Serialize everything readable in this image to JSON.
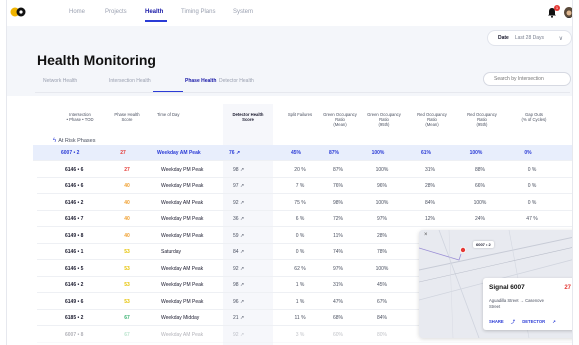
{
  "nav": {
    "items": [
      {
        "label": "Home",
        "active": false
      },
      {
        "label": "Projects",
        "active": false
      },
      {
        "label": "Health",
        "active": true
      },
      {
        "label": "Timing Plans",
        "active": false
      },
      {
        "label": "System",
        "active": false
      }
    ],
    "notification_count": "1"
  },
  "date_filter": {
    "label": "Date",
    "value": "Last 28 Days"
  },
  "page_title": "Health Monitoring",
  "tabs": [
    {
      "label": "Network Health",
      "active": false
    },
    {
      "label": "Intersection Health",
      "active": false
    },
    {
      "label": "Phase Health",
      "active": true
    },
    {
      "label": "Detector Health",
      "active": false
    }
  ],
  "search": {
    "placeholder": "Search by Intersection"
  },
  "table": {
    "headers": {
      "intersection": "Intersection",
      "intersection_sub": "• Phase • TOD",
      "score": "Phase Health",
      "score_sub": "Score",
      "tod": "Time of Day",
      "dhs": "Detector Health",
      "dhs_sub": "Score",
      "sf": "Split Failures",
      "gm": "Green Occupancy",
      "gm_sub": "Ratio",
      "gm_sub2": "(Mean)",
      "g5": "Green Occupancy",
      "g5_sub": "Ratio",
      "g5_sub2": "(95th)",
      "rm": "Red Occupancy",
      "rm_sub": "Ratio",
      "rm_sub2": "(Mean)",
      "r5": "Red Occupancy",
      "r5_sub": "Ratio",
      "r5_sub2": "(95th)",
      "go": "Gap Outs",
      "go_sub": "(% of Cycles)"
    },
    "group_label": "At Risk Phases",
    "rows": [
      {
        "id": "6007 • 2",
        "score": "27",
        "tod": "Weekday AM Peak",
        "dhs": "76 ↗",
        "sf": "45%",
        "gm": "87%",
        "g5": "100%",
        "rm": "61%",
        "r5": "100%",
        "go": "0%"
      },
      {
        "id": "6146 • 6",
        "score": "27",
        "tod": "Weekday PM Peak",
        "dhs": "98 ↗",
        "sf": "20 %",
        "gm": "87%",
        "g5": "100%",
        "rm": "31%",
        "r5": "88%",
        "go": "0 %"
      },
      {
        "id": "6146 • 6",
        "score": "40",
        "tod": "Weekday PM Peak",
        "dhs": "97 ↗",
        "sf": "7 %",
        "gm": "76%",
        "g5": "96%",
        "rm": "28%",
        "r5": "66%",
        "go": "0 %"
      },
      {
        "id": "6146 • 2",
        "score": "40",
        "tod": "Weekday AM Peak",
        "dhs": "92 ↗",
        "sf": "75 %",
        "gm": "98%",
        "g5": "100%",
        "rm": "84%",
        "r5": "100%",
        "go": "0 %"
      },
      {
        "id": "6146 • 7",
        "score": "40",
        "tod": "Weekday PM Peak",
        "dhs": "36 ↗",
        "sf": "6 %",
        "gm": "72%",
        "g5": "97%",
        "rm": "12%",
        "r5": "24%",
        "go": "47 %"
      },
      {
        "id": "6149 • 8",
        "score": "40",
        "tod": "Weekday PM Peak",
        "dhs": "59 ↗",
        "sf": "0 %",
        "gm": "11%",
        "g5": "28%",
        "rm": "",
        "r5": "",
        "go": ""
      },
      {
        "id": "6146 • 1",
        "score": "53",
        "tod": "Saturday",
        "dhs": "84 ↗",
        "sf": "0 %",
        "gm": "74%",
        "g5": "78%",
        "rm": "",
        "r5": "",
        "go": ""
      },
      {
        "id": "6146 • 5",
        "score": "53",
        "tod": "Weekday AM Peak",
        "dhs": "92 ↗",
        "sf": "62 %",
        "gm": "97%",
        "g5": "100%",
        "rm": "",
        "r5": "",
        "go": ""
      },
      {
        "id": "6146 • 2",
        "score": "53",
        "tod": "Weekday PM Peak",
        "dhs": "98 ↗",
        "sf": "1 %",
        "gm": "31%",
        "g5": "45%",
        "rm": "",
        "r5": "",
        "go": ""
      },
      {
        "id": "6149 • 6",
        "score": "53",
        "tod": "Weekday PM Peak",
        "dhs": "96 ↗",
        "sf": "1 %",
        "gm": "47%",
        "g5": "67%",
        "rm": "",
        "r5": "",
        "go": ""
      },
      {
        "id": "6185 • 2",
        "score": "67",
        "tod": "Weekday Midday",
        "dhs": "21 ↗",
        "sf": "11 %",
        "gm": "68%",
        "g5": "84%",
        "rm": "",
        "r5": "",
        "go": ""
      },
      {
        "id": "6007 • 8",
        "score": "67",
        "tod": "Weekday AM Peak",
        "dhs": "92 ↗",
        "sf": "3 %",
        "gm": "60%",
        "g5": "80%",
        "rm": "",
        "r5": "",
        "go": ""
      }
    ]
  },
  "map_popup": {
    "tag": "6007 • 2",
    "signal_title": "Signal 6007",
    "signal_score": "27",
    "address": "Aguadilla Street → Casenove Street",
    "share_label": "SHARE",
    "detector_label": "DETECTOR"
  },
  "colors": {
    "accent": "#2b3cd6",
    "red": "#e53935",
    "orange": "#f0a030",
    "yellow": "#e6c200",
    "green": "#3bb273"
  }
}
